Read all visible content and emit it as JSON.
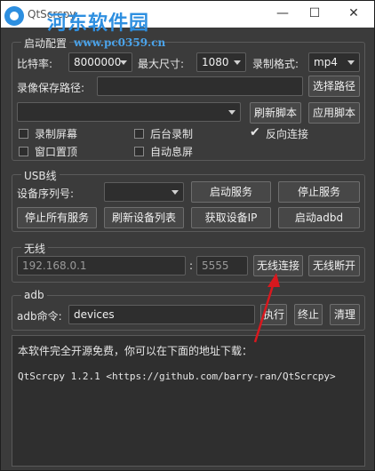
{
  "window": {
    "title": "QtScrcpy",
    "watermark_cn": "河东软件园",
    "watermark_url": "www.pc0359.cn",
    "min_glyph": "—",
    "max_glyph": "☐",
    "close_glyph": "✕"
  },
  "startup": {
    "group_label": "启动配置",
    "bitrate_label": "比特率:",
    "bitrate_value": "8000000",
    "maxsize_label": "最大尺寸:",
    "maxsize_value": "1080",
    "format_label": "录制格式:",
    "format_value": "mp4",
    "savepath_label": "录像保存路径:",
    "savepath_value": "",
    "choose_path_button": "选择路径",
    "script_value": "",
    "refresh_script_button": "刷新脚本",
    "apply_script_button": "应用脚本",
    "record_screen": "录制屏幕",
    "bg_record": "后台录制",
    "reverse_conn": "反向连接",
    "window_top": "窗口置顶",
    "auto_screen_off": "自动息屏",
    "reverse_checked": true
  },
  "usb": {
    "group_label": "USB线",
    "serial_label": "设备序列号:",
    "serial_value": "",
    "start_service": "启动服务",
    "stop_service": "停止服务",
    "stop_all": "停止所有服务",
    "refresh_devices": "刷新设备列表",
    "get_ip": "获取设备IP",
    "start_adbd": "启动adbd"
  },
  "wireless": {
    "group_label": "无线",
    "ip_value": "192.168.0.1",
    "colon": ":",
    "port_value": "5555",
    "connect": "无线连接",
    "disconnect": "无线断开"
  },
  "adb": {
    "group_label": "adb",
    "cmd_label": "adb命令:",
    "cmd_value": "devices",
    "execute": "执行",
    "terminate": "终止",
    "clear": "清理"
  },
  "log": {
    "line1": "本软件完全开源免费，你可以在下面的地址下载：",
    "line2": "QtScrcpy 1.2.1 <https://github.com/barry-ran/QtScrcpy>"
  },
  "colors": {
    "background": "#3b3b3b",
    "watermark": "#2e8fe0",
    "annotation_arrow": "#d8181e"
  }
}
